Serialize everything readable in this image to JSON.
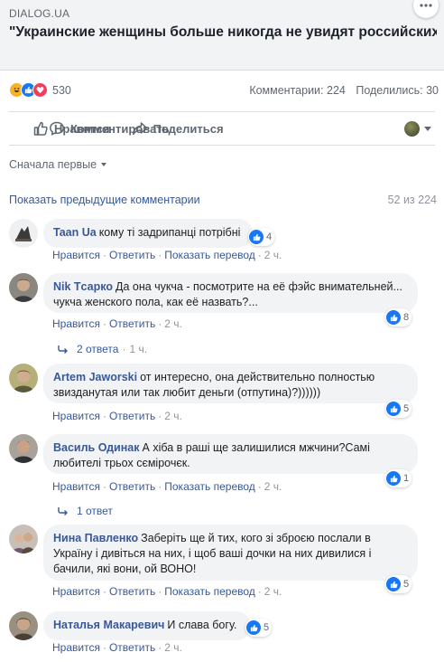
{
  "link": {
    "domain": "DIALOG.UA",
    "title": "\"Украинские женщины больше никогда не увидят российских мужчин\", - Скабеева нагло оскорбила украин…",
    "more_icon": "ellipsis-icon"
  },
  "stats": {
    "reactions": [
      "haha",
      "like",
      "love"
    ],
    "reaction_count": "530",
    "comments_label": "Комментарии: 224",
    "shares_label": "Поделились: 30"
  },
  "actions": {
    "like": "Нравится",
    "comment": "Комментировать",
    "share": "Поделиться"
  },
  "sort_label": "Сначала первые",
  "previous_comments": {
    "label": "Показать предыдущие комментарии",
    "count": "52 из 224"
  },
  "meta_labels": {
    "like": "Нравится",
    "reply": "Ответить",
    "translate": "Показать перевод"
  },
  "comments": [
    {
      "author": "Taan Ua",
      "text": "кому ті задрипанці потрібні",
      "reactions": "4",
      "time": "2 ч.",
      "translate": true,
      "replies": ""
    },
    {
      "author": "Nik Tсарко",
      "text": "Да она чукча - посмотрите на её фэйс внимательней... чукча женского пола, как её назвать?...",
      "reactions": "8",
      "time": "2 ч.",
      "translate": false,
      "replies": "2 ответа",
      "replies_time": "1 ч."
    },
    {
      "author": "Artem Jaworski",
      "text": "от интересно, она действительно полностью звизданутая или так любит деньги (отпутина)?))))))",
      "reactions": "5",
      "time": "2 ч.",
      "translate": false,
      "replies": ""
    },
    {
      "author": "Василь Одинак",
      "text": "А хіба в раші ще залишилися мжчини?Самі любителі трьох сємірочєк.",
      "reactions": "1",
      "time": "2 ч.",
      "translate": true,
      "replies": "1 ответ"
    },
    {
      "author": "Нина Павленко",
      "text": "Заберіть ще й тих, кого зі зброєю послали в Україну і дивіться на них, і щоб ваші дочки на них дивилися і бачили, які вони, ой ВОНО!",
      "reactions": "5",
      "time": "2 ч.",
      "translate": true,
      "replies": ""
    },
    {
      "author": "Наталья Макаревич",
      "text": "И слава богу.",
      "reactions": "5",
      "time": "2 ч.",
      "translate": false,
      "replies": ""
    }
  ],
  "colors": {
    "link": "#385898",
    "muted": "#606770",
    "bubble": "#f2f3f5",
    "like_blue": "#1877f2"
  }
}
